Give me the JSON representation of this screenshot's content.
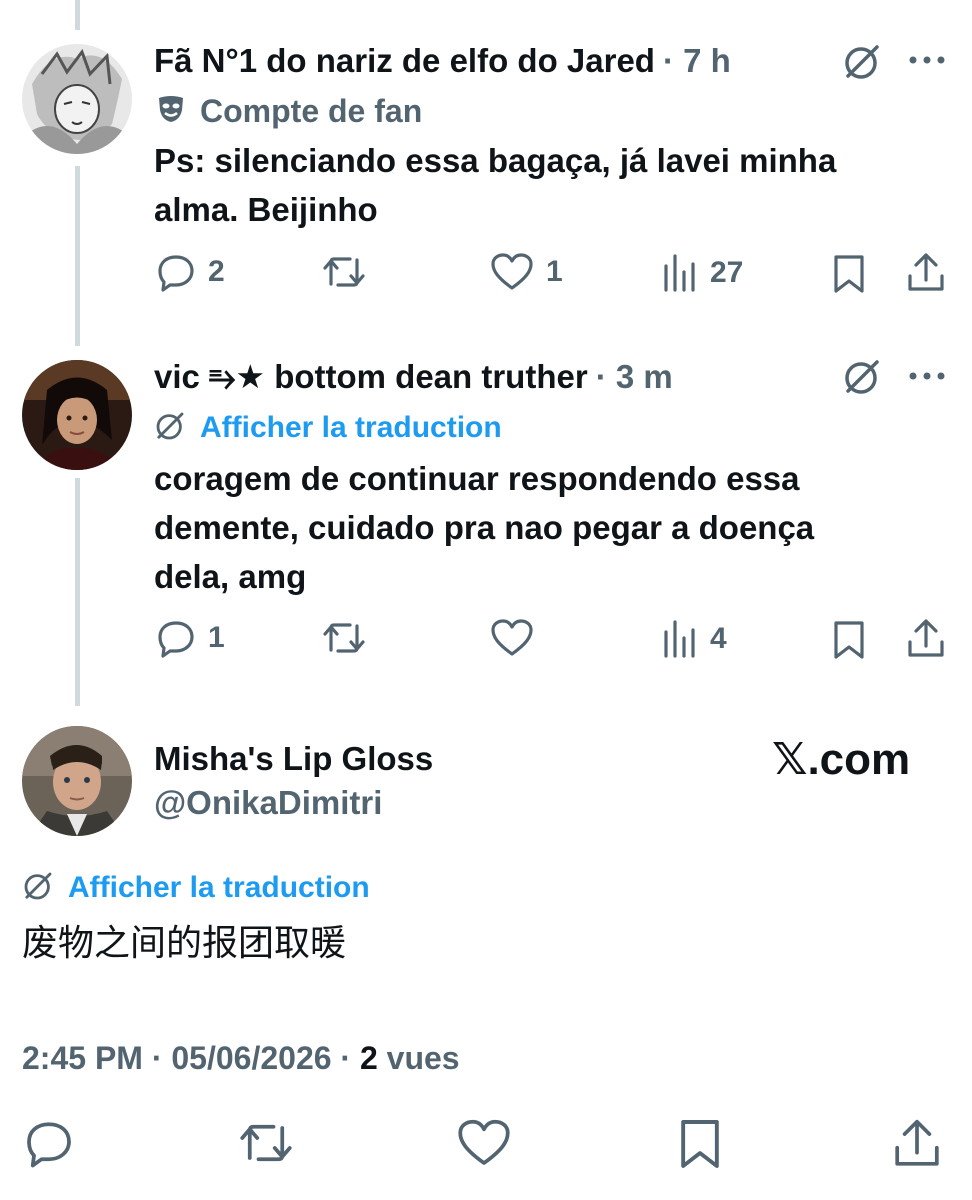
{
  "tweet1": {
    "name": "Fã N°1 do nariz de elfo do Jared",
    "time": "· 7 h",
    "label": "Compte de fan",
    "text_line1": "Ps: silenciando essa bagaça, já lavei minha",
    "text_line2": "alma. Beijinho",
    "replies": "2",
    "likes": "1",
    "views": "27"
  },
  "tweet2": {
    "name": "vic ⥱★ bottom dean truther",
    "time": "· 3 m",
    "translate": "Afficher la traduction",
    "text_line1": "coragem de continuar respondendo essa",
    "text_line2": "demente, cuidado pra nao pegar a doença",
    "text_line3": "dela, amg",
    "replies": "1",
    "likes": "",
    "views": "4"
  },
  "main": {
    "name": "Misha's Lip Gloss",
    "handle": "@OnikaDimitri",
    "site": "𝕏.com",
    "translate": "Afficher la traduction",
    "text": "废物之间的报团取暖",
    "timestamp": "2:45 PM · 05/06/2026 · ",
    "views_count": "2",
    "views_label": " vues"
  },
  "icons": {
    "reply": "reply-icon",
    "retweet": "retweet-icon",
    "like": "like-icon",
    "views": "views-icon",
    "bookmark": "bookmark-icon",
    "share": "share-icon",
    "grok": "grok-icon",
    "more": "more-icon",
    "mask": "mask-icon"
  },
  "colors": {
    "accent": "#1d9bf0",
    "secondary": "#536471",
    "text": "#0f1419"
  }
}
